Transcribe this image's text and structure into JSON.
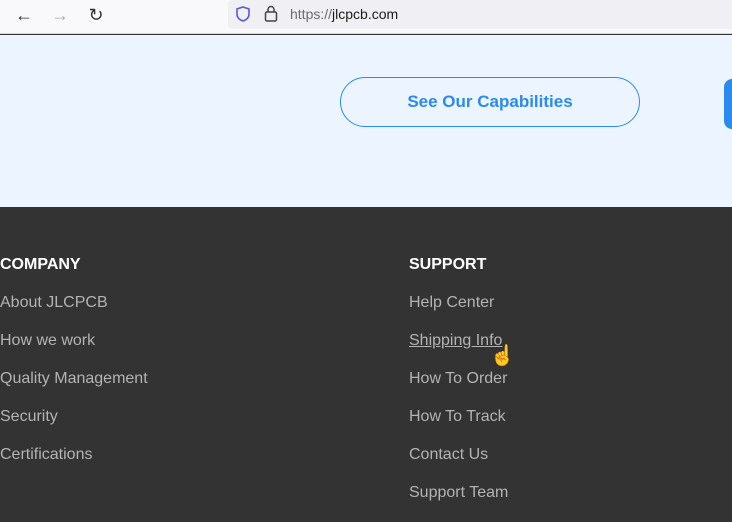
{
  "browser": {
    "url_prefix": "https://",
    "url_domain": "jlcpcb.com"
  },
  "hero": {
    "capabilities_label": "See Our Capabilities"
  },
  "footer": {
    "company": {
      "heading": "COMPANY",
      "items": [
        "About JLCPCB",
        "How we work",
        "Quality Management",
        "Security",
        "Certifications"
      ]
    },
    "support": {
      "heading": "SUPPORT",
      "items": [
        "Help Center",
        "Shipping Info",
        "How To Order",
        "How To Track",
        "Contact Us",
        "Support Team"
      ]
    }
  },
  "colors": {
    "accent": "#2a8af0",
    "footer_bg": "#333333",
    "hero_bg": "#ecf5ff"
  }
}
